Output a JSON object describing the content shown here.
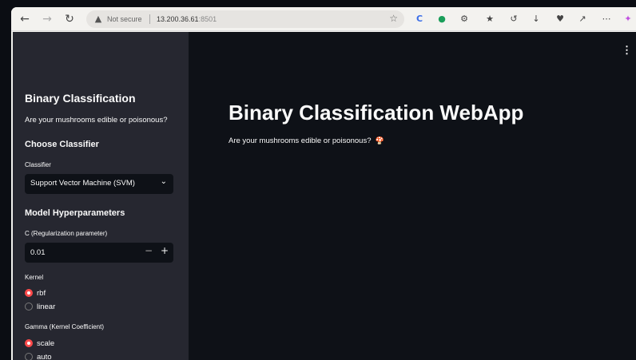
{
  "browser": {
    "security_label": "Not secure",
    "url_host": "13.200.36.61",
    "url_port": ":8501"
  },
  "sidebar": {
    "title": "Binary Classification",
    "subtitle": "Are your mushrooms edible or poisonous?",
    "choose_classifier_heading": "Choose Classifier",
    "classifier_label": "Classifier",
    "classifier_value": "Support Vector Machine (SVM)",
    "hyperparams_heading": "Model Hyperparameters",
    "c_label": "C (Regularization parameter)",
    "c_value": "0.01",
    "kernel_label": "Kernel",
    "kernel_options": [
      "rbf",
      "linear"
    ],
    "kernel_selected": "rbf",
    "gamma_label": "Gamma (Kernel Coefficient)",
    "gamma_options": [
      "scale",
      "auto"
    ],
    "gamma_selected": "scale"
  },
  "main": {
    "title": "Binary Classification WebApp",
    "subtitle": "Are your mushrooms edible or poisonous?",
    "subtitle_icon": "mushroom-icon"
  },
  "colors": {
    "accent": "#ff4b4b",
    "sidebar_bg": "#262730",
    "main_bg": "#0e1117"
  }
}
